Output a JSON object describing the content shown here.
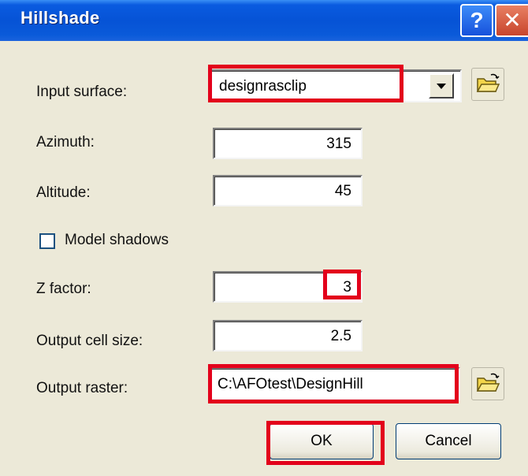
{
  "window": {
    "title": "Hillshade",
    "help_glyph": "?",
    "close_glyph": "✕"
  },
  "form": {
    "input_surface": {
      "label": "Input surface:",
      "value": "designrasclip"
    },
    "azimuth": {
      "label": "Azimuth:",
      "value": "315"
    },
    "altitude": {
      "label": "Altitude:",
      "value": "45"
    },
    "model_shadows": {
      "label": "Model shadows",
      "checked": false
    },
    "z_factor": {
      "label": "Z factor:",
      "value": "3"
    },
    "output_cell_size": {
      "label": "Output cell size:",
      "value": "2.5"
    },
    "output_raster": {
      "label": "Output raster:",
      "value": "C:\\AFOtest\\DesignHill"
    }
  },
  "buttons": {
    "ok": "OK",
    "cancel": "Cancel"
  },
  "icons": [
    "help-icon",
    "close-icon",
    "dropdown-arrow-icon",
    "open-folder-icon"
  ],
  "colors": {
    "title_bar": "#0653d6",
    "dialog_bg": "#ece9d8",
    "highlight": "#e3001b"
  }
}
